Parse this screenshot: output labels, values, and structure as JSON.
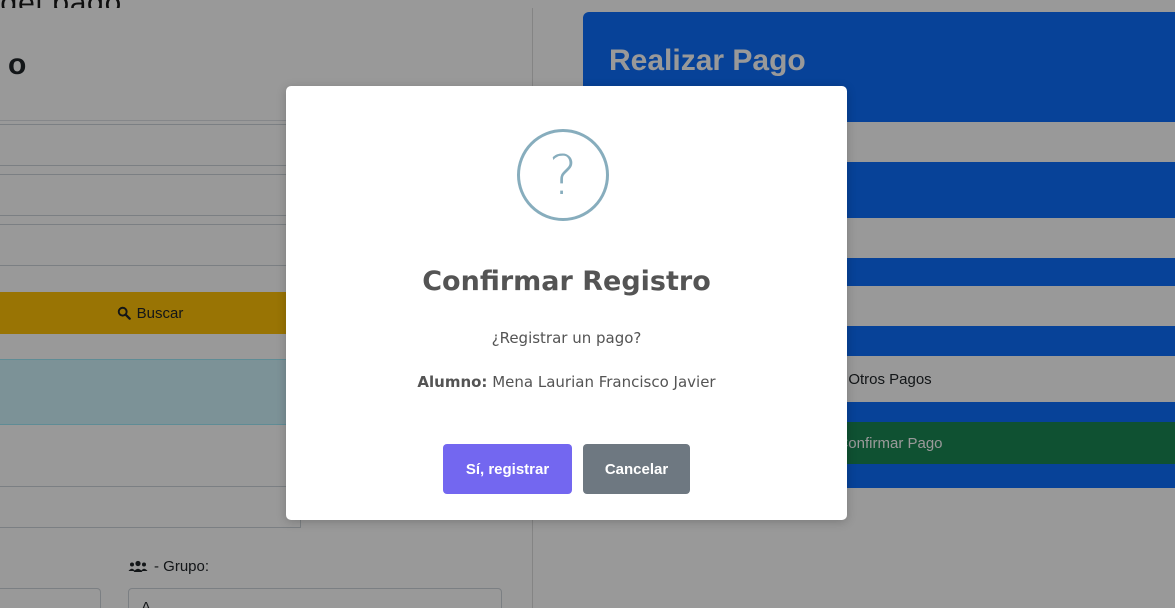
{
  "top_clip_text": "del pago.",
  "left_card": {
    "title_partial": "o",
    "search_button_label": "Buscar",
    "group_label": "- Grupo:",
    "group_value": "A"
  },
  "right_card": {
    "title": "Realizar Pago",
    "other_payments_label": "Otros Pagos",
    "confirm_payment_label": "Confirmar Pago"
  },
  "modal": {
    "icon": "question-icon",
    "icon_glyph": "?",
    "title": "Confirmar Registro",
    "question": "¿Registrar un pago?",
    "student_label": "Alumno:",
    "student_name": "Mena Laurian Francisco Javier",
    "confirm_label": "Sí, registrar",
    "cancel_label": "Cancelar"
  },
  "colors": {
    "right_card_bg": "#0d6efd",
    "search_button_bg": "#ffc107",
    "confirm_payment_bg": "#198754",
    "modal_confirm_bg": "#7367f0",
    "modal_cancel_bg": "#6e7881",
    "modal_icon_color": "#87adbd"
  }
}
